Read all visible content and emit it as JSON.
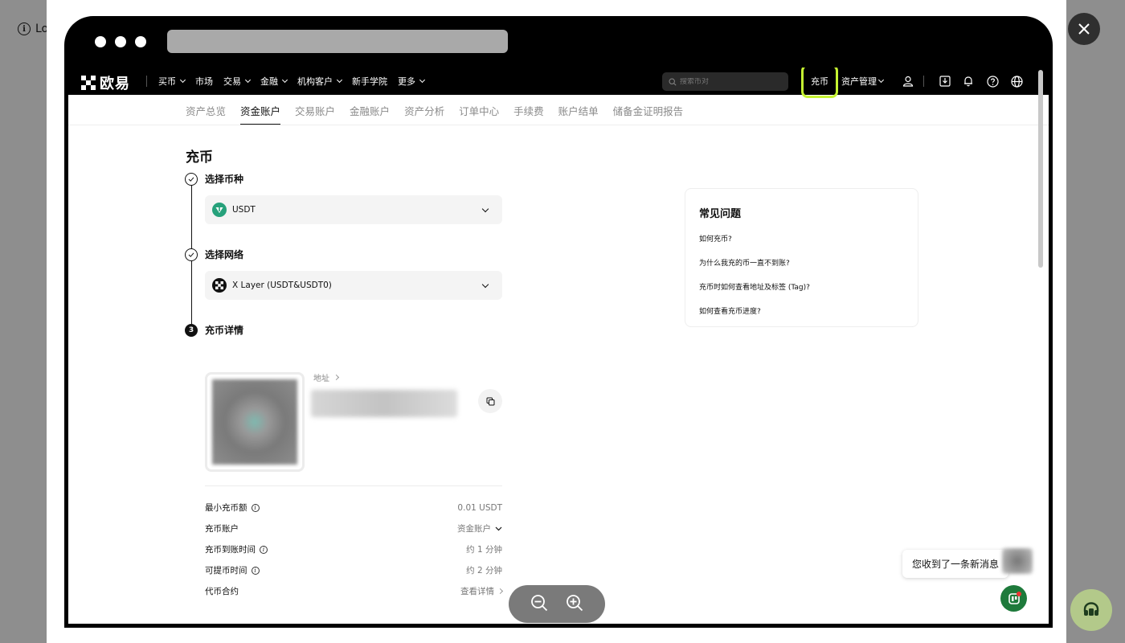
{
  "background": {
    "notice_text": "Lo"
  },
  "site": {
    "logo_text": "欧易",
    "nav": [
      {
        "label": "买币",
        "dropdown": true
      },
      {
        "label": "市场",
        "dropdown": false
      },
      {
        "label": "交易",
        "dropdown": true
      },
      {
        "label": "金融",
        "dropdown": true
      },
      {
        "label": "机构客户",
        "dropdown": true
      },
      {
        "label": "新手学院",
        "dropdown": false
      },
      {
        "label": "更多",
        "dropdown": true
      }
    ],
    "search_placeholder": "搜索币对",
    "deposit_label": "充币",
    "asset_mgmt_label": "资产管理",
    "highlight_color": "#c6f432"
  },
  "tabs": [
    "资产总览",
    "资金账户",
    "交易账户",
    "金融账户",
    "资产分析",
    "订单中心",
    "手续费",
    "账户结单",
    "储备金证明报告"
  ],
  "active_tab_index": 1,
  "page": {
    "title": "充币",
    "steps": [
      {
        "number": "1",
        "label": "选择币种",
        "value": "USDT",
        "icon": "usdt-icon",
        "done": true
      },
      {
        "number": "2",
        "label": "选择网络",
        "value": "X Layer (USDT&USDT0)",
        "icon": "x-layer-icon",
        "done": true
      },
      {
        "number": "3",
        "label": "充币详情",
        "done": false
      }
    ],
    "address_label": "地址",
    "details": [
      {
        "label": "最小充币额",
        "info": true,
        "value": "0.01 USDT",
        "suffix": ""
      },
      {
        "label": "充币账户",
        "info": false,
        "value": "资金账户",
        "suffix": "dropdown"
      },
      {
        "label": "充币到账时间",
        "info": true,
        "value": "约 1 分钟",
        "suffix": ""
      },
      {
        "label": "可提币时间",
        "info": true,
        "value": "约 2 分钟",
        "suffix": ""
      },
      {
        "label": "代币合约",
        "info": false,
        "value": "查看详情",
        "suffix": "arrow"
      }
    ]
  },
  "faq": {
    "title": "常见问题",
    "items": [
      "如何充币?",
      "为什么我充的币一直不到账?",
      "充币时如何查看地址及标签 (Tag)?",
      "如何查看充币进度?"
    ]
  },
  "message_popup": "您收到了一条新消息",
  "colors": {
    "chat_button": "#1e7a3b",
    "usdt": "#26a17b"
  }
}
